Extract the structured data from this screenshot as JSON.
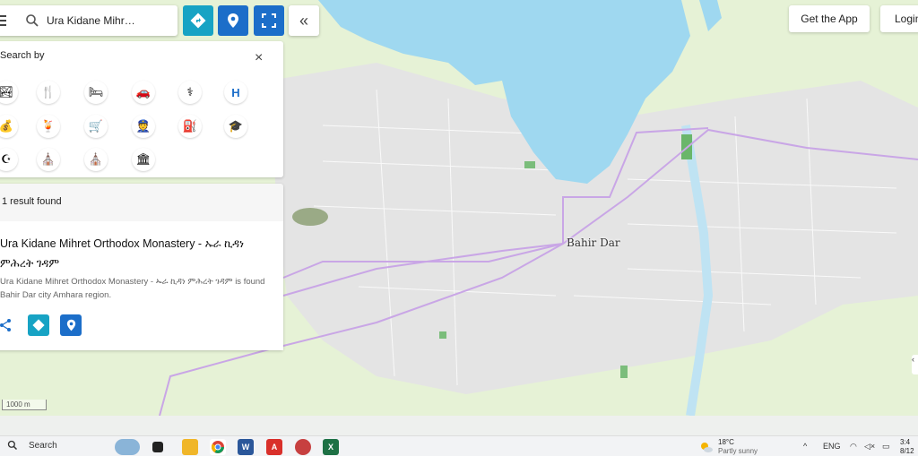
{
  "search": {
    "value": "Ura Kidane Mihr…"
  },
  "top_right": {
    "get_app_label": "Get the App",
    "login_label": "Login"
  },
  "categories": {
    "title": "Search by",
    "close_label": "×",
    "items": [
      {
        "name": "outdoor",
        "glyph": "🏞"
      },
      {
        "name": "restaurant",
        "glyph": "🍴"
      },
      {
        "name": "hotel",
        "glyph": "🛏"
      },
      {
        "name": "car-rental",
        "glyph": "🚗"
      },
      {
        "name": "pharmacy",
        "glyph": "⚕"
      },
      {
        "name": "hospital",
        "glyph": "H"
      },
      {
        "name": "bank",
        "glyph": "💰"
      },
      {
        "name": "entertainment",
        "glyph": "🍹"
      },
      {
        "name": "shopping",
        "glyph": "🛒"
      },
      {
        "name": "police",
        "glyph": "👮"
      },
      {
        "name": "fuel",
        "glyph": "⛽"
      },
      {
        "name": "school",
        "glyph": "🎓"
      },
      {
        "name": "mosque",
        "glyph": "☪"
      },
      {
        "name": "church",
        "glyph": "⛪"
      },
      {
        "name": "orthodox-church",
        "glyph": "⛪"
      },
      {
        "name": "government",
        "glyph": "🏛"
      }
    ]
  },
  "results": {
    "count_text": "1 result found",
    "name": "Ura Kidane Mihret Orthodox Monastery - ኡራ ኪዳነ ምሕረት ገዳም",
    "description": "Ura Kidane Mihret Orthodox Monastery - ኡራ ኪዳነ ምሕረት ገዳም is found Bahir Dar city Amhara region."
  },
  "map": {
    "city_label": "Bahir Dar",
    "scale_label": "1000 m",
    "water_color": "#9fd8f0",
    "land_color": "#e6f2d6",
    "urban_color": "#e4e4e4",
    "route_color": "#c9a6e6"
  },
  "colors": {
    "accent_teal": "#17a3c4",
    "accent_blue": "#1c6ec9"
  },
  "taskbar": {
    "search_label": "Search",
    "weather_temp": "18°C",
    "weather_cond": "Partly sunny",
    "lang": "ENG",
    "time": "3:4",
    "date": "8/12"
  }
}
